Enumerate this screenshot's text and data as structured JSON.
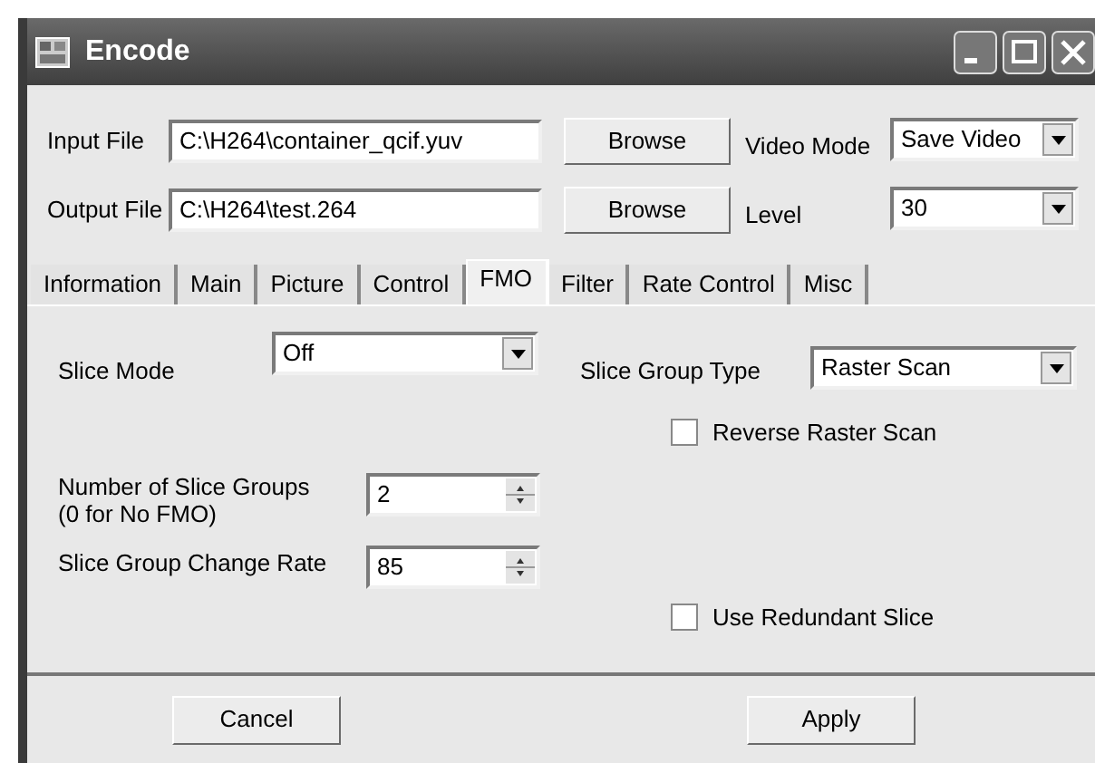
{
  "window": {
    "title": "Encode"
  },
  "input_file": {
    "label": "Input File",
    "value": "C:\\H264\\container_qcif.yuv",
    "button": "Browse"
  },
  "output_file": {
    "label": "Output File",
    "value": "C:\\H264\\test.264",
    "button": "Browse"
  },
  "video_mode": {
    "label": "Video Mode",
    "value": "Save Video"
  },
  "level": {
    "label": "Level",
    "value": "30"
  },
  "tabs": [
    {
      "label": "Information",
      "selected": false
    },
    {
      "label": "Main",
      "selected": false
    },
    {
      "label": "Picture",
      "selected": false
    },
    {
      "label": "Control",
      "selected": false
    },
    {
      "label": "FMO",
      "selected": true
    },
    {
      "label": "Filter",
      "selected": false
    },
    {
      "label": "Rate Control",
      "selected": false
    },
    {
      "label": "Misc",
      "selected": false
    }
  ],
  "slice_mode": {
    "label": "Slice Mode",
    "value": "Off"
  },
  "slice_group_type": {
    "label": "Slice Group Type",
    "value": "Raster Scan"
  },
  "reverse_raster_scan": {
    "label": "Reverse Raster Scan",
    "checked": false
  },
  "number_of_slice_groups": {
    "label": "Number of Slice Groups",
    "note": "(0 for No FMO)",
    "value": "2"
  },
  "slice_group_change_rate": {
    "label": "Slice Group Change Rate",
    "value": "85"
  },
  "use_redundant_slice": {
    "label": "Use Redundant Slice",
    "checked": false
  },
  "buttons": [
    "Cancel",
    "Apply"
  ]
}
